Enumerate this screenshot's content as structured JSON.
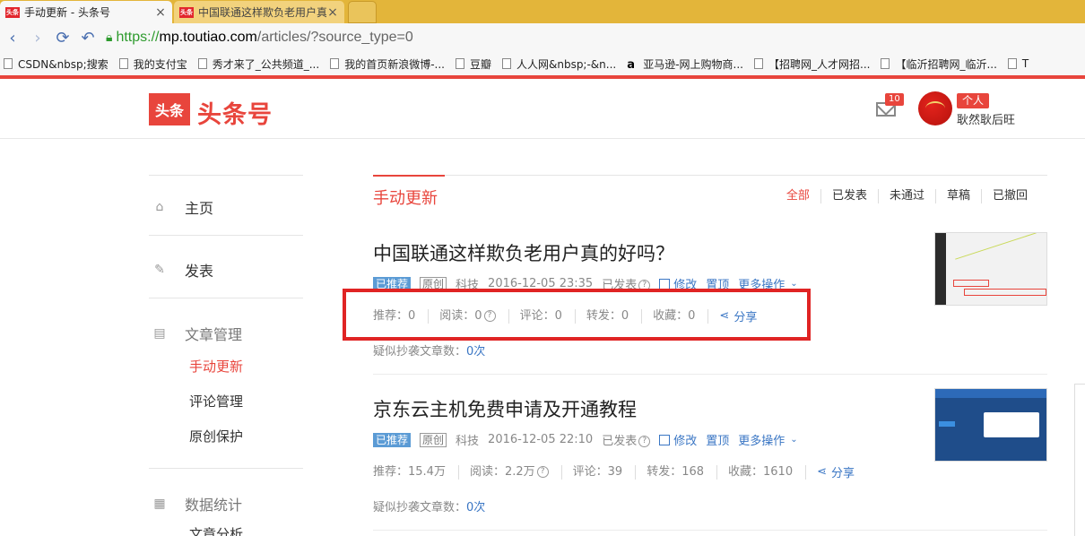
{
  "browser": {
    "tabs": [
      {
        "title": "手动更新 - 头条号",
        "favicon": "头条",
        "active": true
      },
      {
        "title": "中国联通这样欺负老用户真",
        "favicon": "头条",
        "active": false
      }
    ],
    "url": {
      "scheme": "https://",
      "host": "mp.toutiao.com",
      "path": "/articles/?source_type=0"
    },
    "bookmarks": [
      "CSDN&nbsp;搜索",
      "我的支付宝",
      "秀才来了_公共频道_...",
      "我的首页新浪微博-...",
      "豆瓣",
      "人人网&nbsp;-&n...",
      "亚马逊-网上购物商...",
      "【招聘网_人才网招...",
      "【临沂招聘网_临沂...",
      "T"
    ]
  },
  "header": {
    "logo_box": "头条",
    "logo_text": "头条号",
    "mail_count": "10",
    "user_badge": "个人",
    "user_name": "耿然耿后旺"
  },
  "sidebar": {
    "home": "主页",
    "publish": "发表",
    "article_mgmt": "文章管理",
    "sub_manual": "手动更新",
    "sub_comments": "评论管理",
    "sub_original": "原创保护",
    "data_stats": "数据统计",
    "sub_analysis": "文章分析"
  },
  "main": {
    "title": "手动更新",
    "filters": [
      "全部",
      "已发表",
      "未通过",
      "草稿",
      "已撤回"
    ],
    "articles": [
      {
        "title": "中国联通这样欺负老用户真的好吗？",
        "tag_recommended": "已推荐",
        "tag_original": "原创",
        "category": "科技",
        "date": "2016-12-05 23:35",
        "status": "已发表",
        "edit": "修改",
        "top": "置顶",
        "more": "更多操作",
        "stats": {
          "recommend": "推荐：0",
          "read": "阅读：0",
          "comment": "评论：0",
          "forward": "转发：0",
          "favorite": "收藏：0",
          "share": "分享"
        },
        "plagiarism_label": "疑似抄袭文章数：",
        "plagiarism_count": "0次"
      },
      {
        "title": "京东云主机免费申请及开通教程",
        "tag_recommended": "已推荐",
        "tag_original": "原创",
        "category": "科技",
        "date": "2016-12-05 22:10",
        "status": "已发表",
        "edit": "修改",
        "top": "置顶",
        "more": "更多操作",
        "stats": {
          "recommend": "推荐：15.4万",
          "read": "阅读：2.2万",
          "comment": "评论：39",
          "forward": "转发：168",
          "favorite": "收藏：1610",
          "share": "分享"
        },
        "plagiarism_label": "疑似抄袭文章数：",
        "plagiarism_count": "0次"
      }
    ]
  },
  "colors": {
    "brand_red": "#e8453c",
    "link_blue": "#3a76c4",
    "highlight_red": "#e02424"
  }
}
